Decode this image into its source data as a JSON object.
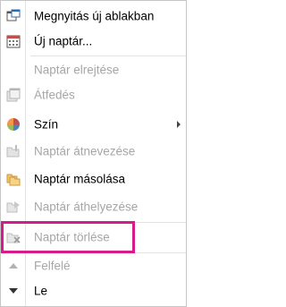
{
  "menu": {
    "items": [
      {
        "label": "Megnyitás új ablakban",
        "icon": "open-in-new-window-icon",
        "enabled": true
      },
      {
        "label": "Új naptár...",
        "icon": "new-calendar-icon",
        "enabled": true
      },
      {
        "label": "Naptár elrejtése",
        "icon": "",
        "enabled": false
      },
      {
        "label": "Átfedés",
        "icon": "overlay-calendar-icon",
        "enabled": false
      },
      {
        "label": "Szín",
        "icon": "color-palette-icon",
        "enabled": true,
        "has_submenu": true
      },
      {
        "label": "Naptár átnevezése",
        "icon": "rename-calendar-icon",
        "enabled": false
      },
      {
        "label": "Naptár másolása",
        "icon": "copy-calendar-icon",
        "enabled": true
      },
      {
        "label": "Naptár áthelyezése",
        "icon": "move-calendar-icon",
        "enabled": false
      },
      {
        "label": "Naptár törlése",
        "icon": "delete-calendar-icon",
        "enabled": false,
        "highlighted": true
      },
      {
        "label": "Felfelé",
        "icon": "move-up-arrow-icon",
        "enabled": false
      },
      {
        "label": "Le",
        "icon": "move-down-arrow-icon",
        "enabled": true
      }
    ]
  },
  "colors": {
    "highlight_border": "#d81b8c",
    "disabled_text": "#a6a6a6",
    "enabled_text": "#000000",
    "menu_border": "#c6c6c6",
    "accent_blue": "#2b6cb3"
  }
}
